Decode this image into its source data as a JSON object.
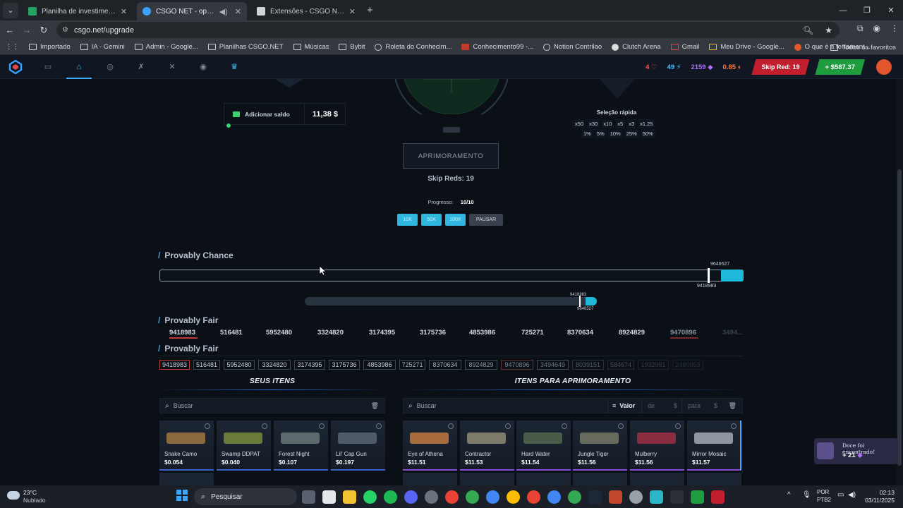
{
  "browser": {
    "tabs": [
      {
        "title": "Planilha de investimentos - CSGO",
        "color": "#1fa463",
        "active": false
      },
      {
        "title": "CSGO NET - open the best",
        "color": "#3aa0ff",
        "active": true
      },
      {
        "title": "Extensões - CSGO NET Profit H",
        "color": "#cfd3d8",
        "active": false
      }
    ],
    "url": "csgo.net/upgrade",
    "bookmarks": [
      "Importado",
      "IA - Gemini",
      "Admin - Google...",
      "Planilhas CSGO.NET",
      "Músicas",
      "Bybit",
      "Roleta do Conhecim...",
      "Conhecimento99 -...",
      "Notion Contrilao",
      "Clutch Arena",
      "Gmail",
      "Meu Drive - Google...",
      "O que é a ferrament..."
    ],
    "all_favorites": "Todos os favoritos"
  },
  "header": {
    "stat_lives": "4",
    "stat_lightning": "49",
    "stat_gems": "2159",
    "stat_coins": "0.85",
    "skip_red_label": "Skip Red: 19",
    "balance_label": "+ $587.37"
  },
  "upgrade": {
    "add_balance_label": "Adicionar saldo",
    "balance_value": "11,38 $",
    "quick_select_title": "Seleção rápida",
    "multipliers": [
      "x50",
      "x30",
      "x10",
      "x5",
      "x3",
      "x1.25"
    ],
    "percents": [
      "1%",
      "5%",
      "10%",
      "25%",
      "50%"
    ],
    "upgrade_button": "APRIMORAMENTO",
    "skip_reds": "Skip Reds: 19",
    "progress_label": "Progresso:",
    "progress_value": "10/10",
    "auto_buttons": [
      "10X",
      "50X",
      "100X",
      "PAUSAR"
    ]
  },
  "provably_chance": {
    "title": "Provably Chance",
    "top_value": "9646527",
    "bottom_value": "9418983",
    "mini_top_value": "9418983",
    "mini_bottom_value": "9646527"
  },
  "provably_fair_1": {
    "title": "Provably Fair",
    "values": [
      "9418983",
      "516481",
      "5952480",
      "3324820",
      "3174395",
      "3175736",
      "4853986",
      "725271",
      "8370634",
      "8924829",
      "9470896",
      "3494..."
    ]
  },
  "provably_fair_2": {
    "title": "Provably Fair",
    "values": [
      "9418983",
      "516481",
      "5952480",
      "3324820",
      "3174395",
      "3175736",
      "4853986",
      "725271",
      "8370634",
      "8924829",
      "9470896",
      "3494649",
      "8039151",
      "584674",
      "1932991",
      "2480053"
    ]
  },
  "my_items": {
    "title": "SEUS ITENS",
    "search_placeholder": "Buscar",
    "items": [
      {
        "name": "Snake Camo",
        "price": "$0.054",
        "color": "#8b6a3e"
      },
      {
        "name": "Swamp DDPAT",
        "price": "$0.040",
        "color": "#6a7a3a"
      },
      {
        "name": "Forest Night",
        "price": "$0.107",
        "color": "#5d6a6d"
      },
      {
        "name": "Lil' Cap Gun",
        "price": "$0.197",
        "color": "#4e5a66"
      }
    ]
  },
  "upgrade_items": {
    "title": "ITENS PARA APRIMORAMENTO",
    "search_placeholder": "Buscar",
    "sort_label": "Valor",
    "from_label": "de",
    "to_label": "para",
    "currency": "$",
    "items": [
      {
        "name": "Eye of Athena",
        "price": "$11.51",
        "color": "#a86b3b"
      },
      {
        "name": "Contractor",
        "price": "$11.53",
        "color": "#7d7a6a"
      },
      {
        "name": "Hard Water",
        "price": "$11.54",
        "color": "#4a5b4a"
      },
      {
        "name": "Jungle Tiger",
        "price": "$11.56",
        "color": "#676b5e"
      },
      {
        "name": "Mulberry",
        "price": "$11.56",
        "color": "#8a2c3f"
      },
      {
        "name": "Mirror Mosaic",
        "price": "$11.57",
        "color": "#8f96a1"
      }
    ]
  },
  "toast": {
    "title": "Doce foi encontrado!",
    "value": "+ 21"
  },
  "taskbar": {
    "temperature": "23°C",
    "weather": "Nublado",
    "search_placeholder": "Pesquisar",
    "lang": "POR",
    "layout": "PTB2",
    "time": "02:13",
    "date": "03/11/2025"
  },
  "colors": {
    "accent": "#3fc7ff",
    "skip_red": "#c21f2e",
    "balance_green": "#1f9c3e",
    "chance_fill": "#1fb8d8"
  }
}
